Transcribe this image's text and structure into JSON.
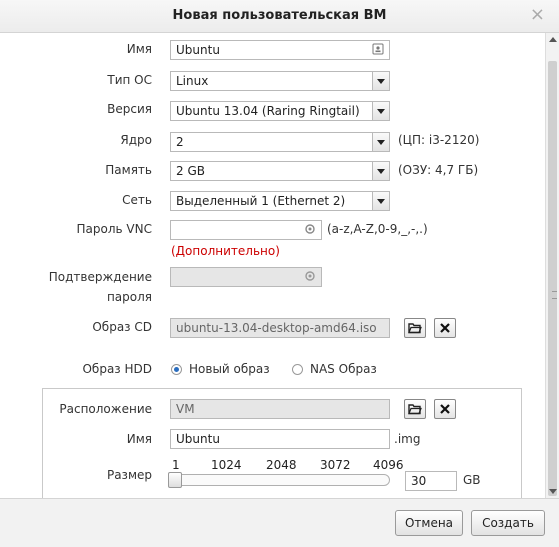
{
  "dialog": {
    "title": "Новая пользовательская ВМ",
    "close_glyph": "×"
  },
  "form": {
    "name": {
      "label": "Имя",
      "value": "Ubuntu",
      "icon": "contact-card-icon"
    },
    "os_type": {
      "label": "Тип ОС",
      "value": "Linux"
    },
    "version": {
      "label": "Версия",
      "value": "Ubuntu 13.04 (Raring Ringtail)"
    },
    "cores": {
      "label": "Ядро",
      "value": "2",
      "hint": "(ЦП: i3-2120)"
    },
    "memory": {
      "label": "Память",
      "value": "2 GB",
      "hint": "(ОЗУ: 4,7 ГБ)"
    },
    "network": {
      "label": "Сеть",
      "value": "Выделенный 1 (Ethernet 2)"
    },
    "vnc_password": {
      "label": "Пароль VNC",
      "value": "",
      "hint": "(a-z,A-Z,0-9,_,-,.)",
      "advanced_link": "(Дополнительно)",
      "icon": "refresh-icon"
    },
    "confirm_password": {
      "label_line1": "Подтверждение",
      "label_line2": "пароля",
      "value": "",
      "icon": "refresh-icon"
    },
    "cd_image": {
      "label": "Образ CD",
      "value": "ubuntu-13.04-desktop-amd64.iso"
    },
    "hdd_image": {
      "label": "Образ HDD",
      "options": [
        {
          "label": "Новый образ",
          "selected": true
        },
        {
          "label": "NAS Образ",
          "selected": false
        }
      ]
    },
    "location": {
      "label": "Расположение",
      "value": "VM"
    },
    "disk_name": {
      "label": "Имя",
      "value": "Ubuntu",
      "suffix": ".img"
    },
    "size": {
      "label": "Размер",
      "ticks": [
        "1",
        "1024",
        "2048",
        "3072",
        "4096"
      ],
      "value": "30",
      "unit": "GB",
      "slider_level": 30
    }
  },
  "buttons": {
    "cancel": "Отмена",
    "create": "Создать"
  },
  "colors": {
    "accent": "#2a6dbf",
    "link_red": "#cc0000",
    "disabled_field": "#e6e6e6"
  }
}
